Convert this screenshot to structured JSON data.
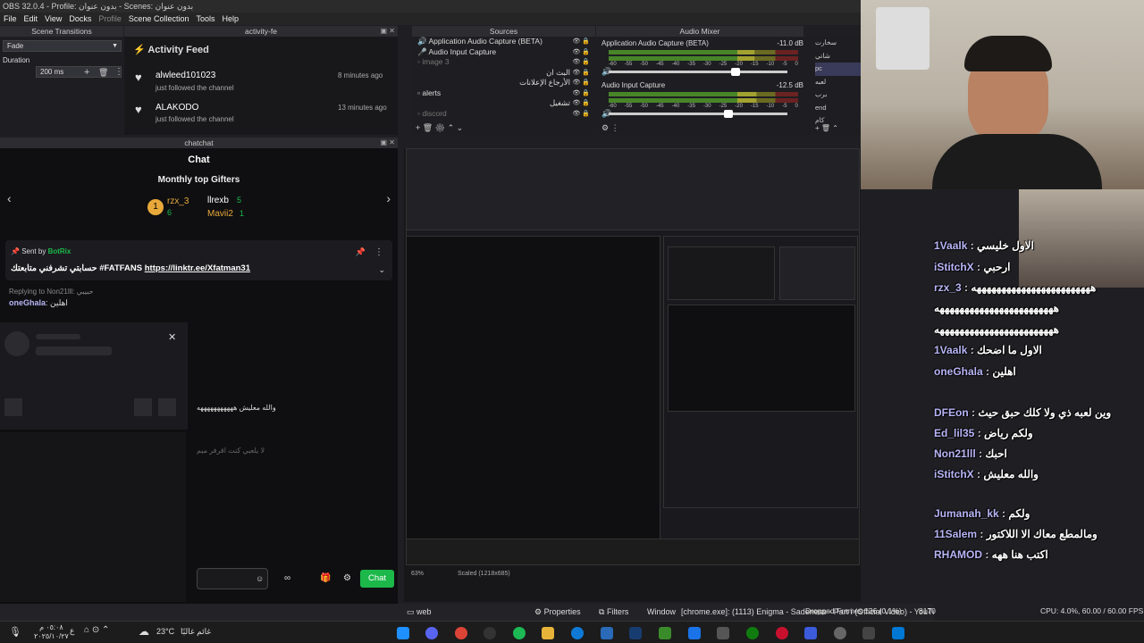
{
  "window": {
    "title": "OBS 32.0.4 - Profile: بدون عنوان - Scenes: بدون عنوان"
  },
  "menu": [
    "File",
    "Edit",
    "View",
    "Docks",
    "Profile",
    "Scene Collection",
    "Tools",
    "Help"
  ],
  "scene_transitions": {
    "header": "Scene Transitions",
    "transition": "Fade",
    "duration_label": "Duration",
    "duration_value": "200 ms"
  },
  "activity_dock": {
    "header": "activity-fe",
    "title": "Activity Feed",
    "items": [
      {
        "user": "alwleed101023",
        "action": "just followed the channel",
        "time": "8 minutes ago"
      },
      {
        "user": "ALAKODO",
        "action": "just followed the channel",
        "time": "13 minutes ago"
      }
    ]
  },
  "sources": {
    "header": "Sources",
    "items": [
      "Application Audio Capture (BETA)",
      "Audio Input Capture",
      "image 3",
      "البث ان",
      "الأرجاع الإعلانات",
      "alerts",
      "تشغيل",
      "discord"
    ]
  },
  "audio_mixer": {
    "header": "Audio Mixer",
    "channels": [
      {
        "name": "Application Audio Capture (BETA)",
        "db": "-11.0 dB",
        "level": 0.77,
        "volume": 0.72
      },
      {
        "name": "Audio Input Capture",
        "db": "-12.5 dB",
        "level": 0.78,
        "volume": 0.68
      }
    ],
    "ticks": [
      "-60",
      "-55",
      "-50",
      "-45",
      "-40",
      "-35",
      "-30",
      "-25",
      "-20",
      "-15",
      "-10",
      "-5",
      "0"
    ]
  },
  "scenes_list": [
    "سخارت",
    "شاتي",
    "pc",
    "لعبه",
    "برب",
    "end",
    "كام"
  ],
  "chat_dock": {
    "header": "chatchat",
    "title": "Chat",
    "gifters_title": "Monthly top Gifters",
    "gifters": [
      {
        "rank": "1",
        "name": "rzx_3",
        "count": "6"
      },
      {
        "name": "llrexb",
        "count": "5"
      },
      {
        "name": "Mavii2",
        "count": "1"
      }
    ],
    "pinned_sender_label": "Sent by",
    "pinned_sender": "BotRix",
    "pinned_message": "حسابتي تشرفني متابعتك #FATFANS",
    "pinned_link": "https://linktr.ee/Xfatman31",
    "reply_to": "Replying to Non21lll: حبيبي",
    "reply_user": "oneGhala",
    "reply_text": "اهلين",
    "line1": "والله معليش هههههههههههه",
    "line2": "لا يلعبي كنت اقرفر ميم",
    "chat_button": "Chat"
  },
  "status_bar": {
    "web_label": "web",
    "properties": "Properties",
    "filters": "Filters",
    "window_label": "Window",
    "window_value": "[chrome.exe]: (1113) Enigma - Sadeness - Part i (Official Video) - YouTube - G",
    "dropped": "Dropped Frames 136 (0.1%)",
    "cpu": "CPU: 4.0%, 60.00 / 60.00 FPS",
    "bitrate": "8170"
  },
  "overlay_chat": [
    {
      "user": "1Vaalk",
      "text": "الاول خليسي"
    },
    {
      "user": "iStitchX",
      "text": "ارحبي"
    },
    {
      "user": "rzx_3",
      "text": "ههههههههههههههههههههههههه"
    },
    {
      "user": "",
      "text": "ههههههههههههههههههههههههه"
    },
    {
      "user": "",
      "text": "ههههههههههههههههههههههههه"
    },
    {
      "user": "1Vaalk",
      "text": "الاول ما اضحك"
    },
    {
      "user": "oneGhala",
      "text": "اهلين"
    },
    {
      "user": "DFEon",
      "text": "وين لعبه ذي ولا كلك حبق حيث"
    },
    {
      "user": "Ed_lil35",
      "text": "ولكم رياض"
    },
    {
      "user": "Non21lll",
      "text": "احبك"
    },
    {
      "user": "iStitchX",
      "text": "والله معليش"
    },
    {
      "user": "Jumanah_kk",
      "text": "ولكم"
    },
    {
      "user": "11Salem",
      "text": "ومالمطع معاك الا اللاكتور"
    },
    {
      "user": "RHAMOD",
      "text": "اكتب هنا ههه"
    }
  ],
  "taskbar": {
    "weather_temp": "23°C",
    "weather_text": "غائم غالبًا",
    "time": "٠٥:٠٨ م",
    "date": "٢٠٢٥/١٠/٢٧",
    "lang": "ع"
  },
  "nested": {
    "zoom": "63%",
    "scaled": "Scaled (1218x685)"
  }
}
